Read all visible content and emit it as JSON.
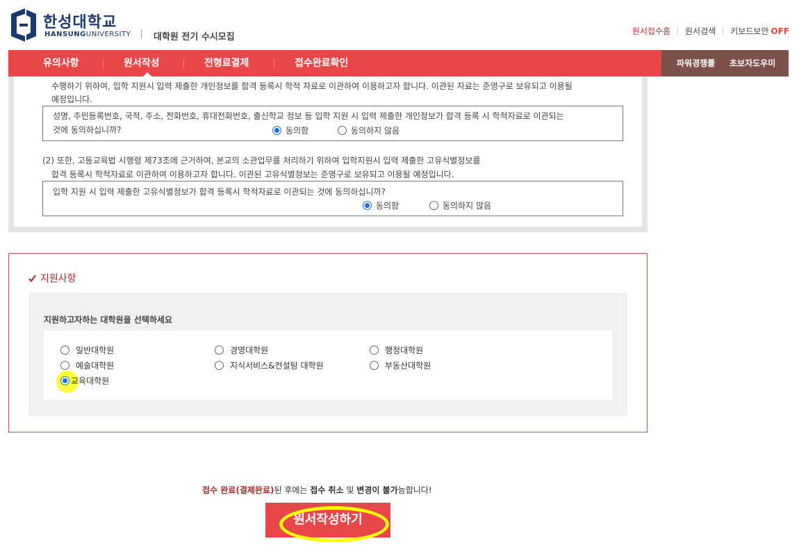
{
  "header": {
    "logo_kr": "한성대학교",
    "logo_en_bold": "HANSUNG",
    "logo_en_thin": "UNIVERSITY",
    "subtitle": "대학원 전기 수시모집",
    "links": {
      "home": "원서접수홈",
      "search": "원서검색",
      "keyboard_security": "키보드보안",
      "keyboard_security_state": "OFF"
    }
  },
  "nav": {
    "items": [
      "유의사항",
      "원서작성",
      "전형료결제",
      "접수완료확인"
    ],
    "active": "원서작성",
    "right_items": [
      "파워경쟁률",
      "초보자도우미"
    ]
  },
  "consent": {
    "intro_line1": "수행하기 위하여, 입학 지원시 입력 제출한 개인정보를 합격 등록시 학적 자료로 이관하여 이용하고자 합니다. 이관된 자료는 준영구로 보유되고 이용될",
    "intro_line2": "예정입니다.",
    "q1_line1": "성명, 주민등록번호, 국적, 주소, 전화번호, 휴대전화번호, 출신학교 정보 등 입학 지원 시 입력 제출한 개인정보가 합격 등록 시 학적자료로 이관되는",
    "q1_line2": "것에 동의하십니까?",
    "q1_agree": "동의함",
    "q1_disagree": "동의하지 않음",
    "q1_selected": "동의함",
    "section2_line1": "(2) 또한, 고등교육법 시행령 제73조에 근거하여, 본교의 소관업무를 처리하기 위하여 입학지원시 입력 제출한 고유식별정보를",
    "section2_line2": "합격 등록시 학적자료로 이관하여 이용하고자 합니다. 이관된 고유식별정보는 준영구로 보유되고 이용될 예정입니다.",
    "q2_line1": "입학 지원 시 입력 제출한 고유식별정보가 합격 등록시 학적자료로 이관되는 것에 동의하십니까?",
    "q2_agree": "동의함",
    "q2_disagree": "동의하지 않음",
    "q2_selected": "동의함"
  },
  "apply": {
    "title": "지원사항",
    "question": "지원하고자하는 대학원을 선택하세요",
    "options": [
      "일반대학원",
      "경영대학원",
      "행정대학원",
      "예술대학원",
      "지식서비스&컨설팅 대학원",
      "부동산대학원",
      "교육대학원"
    ],
    "selected": "교육대학원"
  },
  "footer": {
    "notice_red1": "접수 완료(결제완료)",
    "notice_text1": "된 후에는 ",
    "notice_bold1": "접수 취소",
    "notice_text2": " 및 ",
    "notice_bold2": "변경이 불가",
    "notice_text3": "능합니다!",
    "submit_label": "원서작성하기"
  },
  "colors": {
    "brand_red": "#e8474a",
    "brand_navy": "#1a3a6e",
    "nav_brown": "#7b5149",
    "radio_blue": "#1e6fd9",
    "highlight_yellow": "#ffff00"
  }
}
